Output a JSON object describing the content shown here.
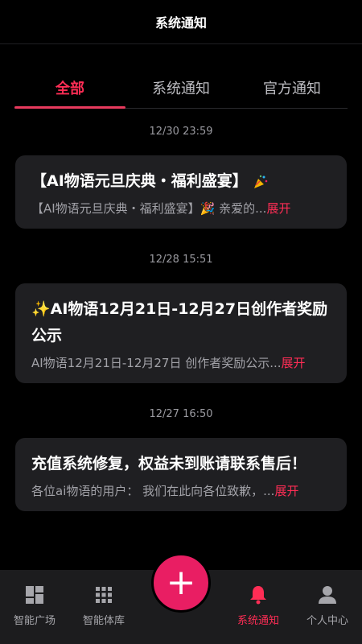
{
  "header": {
    "title": "系统通知"
  },
  "tabs": [
    {
      "label": "全部",
      "active": true
    },
    {
      "label": "系统通知",
      "active": false
    },
    {
      "label": "官方通知",
      "active": false
    }
  ],
  "notifications": [
    {
      "time": "12/30 23:59",
      "title": "【AI物语元旦庆典・福利盛宴】",
      "title_icon": "party-popper-icon",
      "preview": "【AI物语元旦庆典・福利盛宴】🎉 亲爱的...",
      "expand_label": "展开"
    },
    {
      "time": "12/28 15:51",
      "title": "✨AI物语12月21日-12月27日创作者奖励公示",
      "title_icon": "sparkles-icon",
      "preview": "AI物语12月21日-12月27日 创作者奖励公示...",
      "expand_label": "展开"
    },
    {
      "time": "12/27 16:50",
      "title": "充值系统修复，权益未到账请联系售后！",
      "preview": "各位ai物语的用户： 我们在此向各位致歉，...",
      "expand_label": "展开"
    }
  ],
  "bottom_nav": [
    {
      "label": "智能广场",
      "icon": "dashboard-icon",
      "active": false
    },
    {
      "label": "智能体库",
      "icon": "grid-icon",
      "active": false
    },
    {
      "label": "系统通知",
      "icon": "bell-icon",
      "active": true
    },
    {
      "label": "个人中心",
      "icon": "person-icon",
      "active": false
    }
  ],
  "fab": {
    "label": "+",
    "icon": "plus-icon"
  },
  "colors": {
    "accent": "#ff2d55",
    "card_bg": "#1f1f22",
    "background": "#000000"
  }
}
